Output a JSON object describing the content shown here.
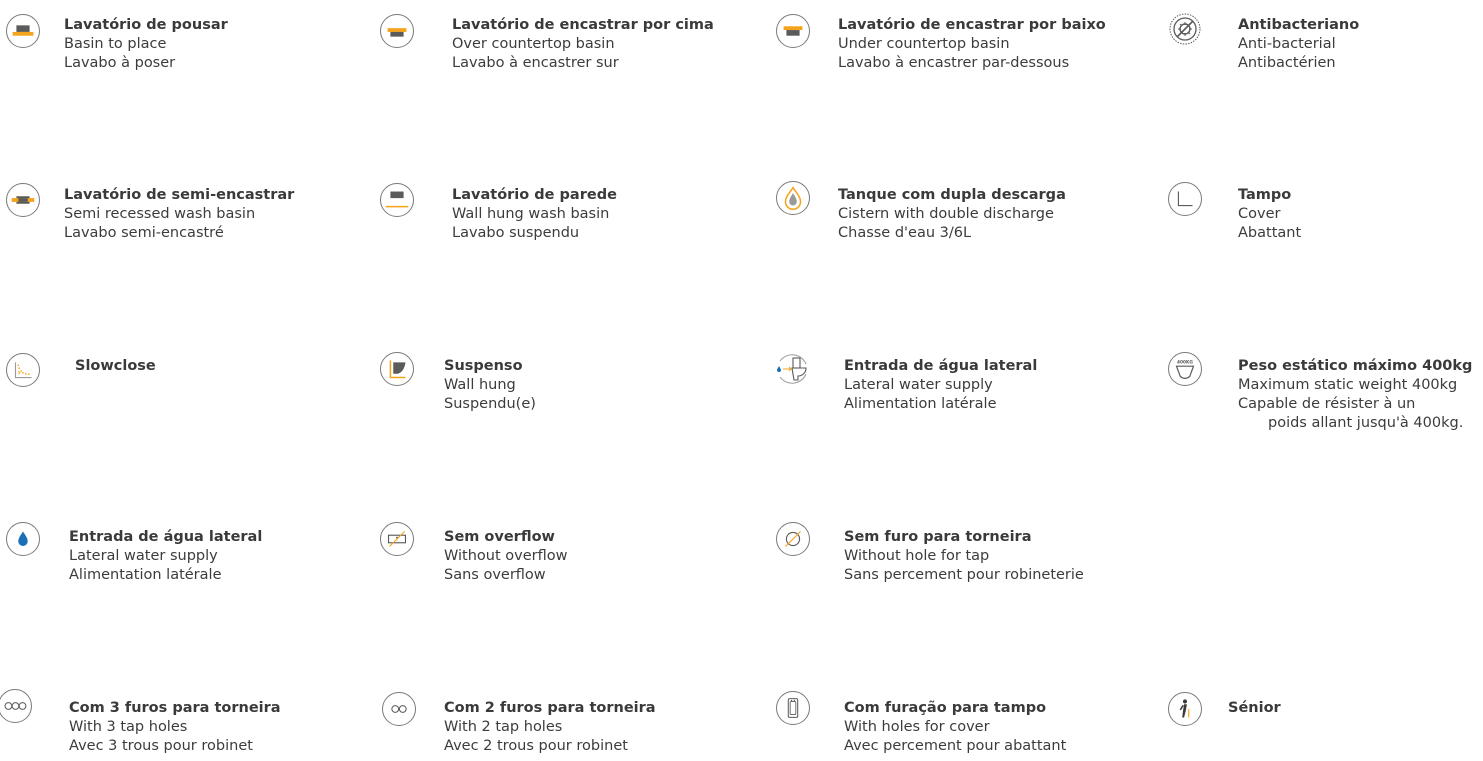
{
  "colors": {
    "accent": "#f4a31a",
    "dark": "#5b5b5b",
    "blue": "#1a6fb5",
    "ring": "#7a7a7a"
  },
  "items": [
    {
      "icon": "basin-to-place-icon",
      "title": "Lavatório de pousar",
      "en": "Basin to place",
      "fr": "Lavabo à poser"
    },
    {
      "icon": "over-countertop-basin-icon",
      "title": "Lavatório de encastrar por cima",
      "en": "Over countertop basin",
      "fr": "Lavabo à encastrer sur"
    },
    {
      "icon": "under-countertop-basin-icon",
      "title": "Lavatório de encastrar por baixo",
      "en": "Under countertop basin",
      "fr": "Lavabo à encastrer par-dessous"
    },
    {
      "icon": "antibacterial-icon",
      "title": "Antibacteriano",
      "en": "Anti-bacterial",
      "fr": "Antibactérien"
    },
    {
      "icon": "semi-recessed-basin-icon",
      "title": "Lavatório de semi-encastrar",
      "en": "Semi recessed wash basin",
      "fr": "Lavabo semi-encastré"
    },
    {
      "icon": "wall-hung-basin-icon",
      "title": "Lavatório de parede",
      "en": "Wall hung wash basin",
      "fr": "Lavabo suspendu"
    },
    {
      "icon": "double-discharge-drop-icon",
      "title": "Tanque com dupla descarga",
      "en": "Cistern with double discharge",
      "fr": "Chasse d'eau 3/6L"
    },
    {
      "icon": "cover-icon",
      "title": "Tampo",
      "en": "Cover",
      "fr": "Abattant"
    },
    {
      "icon": "slowclose-icon",
      "title": "Slowclose"
    },
    {
      "icon": "wall-hung-icon",
      "title": "Suspenso",
      "en": "Wall hung",
      "fr": "Suspendu(e)"
    },
    {
      "icon": "lateral-water-supply-toilet-icon",
      "title": "Entrada de água lateral",
      "en": "Lateral water supply",
      "fr": "Alimentation latérale"
    },
    {
      "icon": "static-weight-400kg-icon",
      "icon_label": "400KG",
      "title": "Peso estático máximo 400kg",
      "en": "Maximum static weight 400kg",
      "fr": "Capable de résister à un",
      "fr2": "poids allant jusqu'à 400kg."
    },
    {
      "icon": "water-drop-icon",
      "title": "Entrada de água lateral",
      "en": "Lateral water supply",
      "fr": "Alimentation latérale"
    },
    {
      "icon": "without-overflow-icon",
      "title": "Sem overflow",
      "en": "Without overflow",
      "fr": "Sans overflow"
    },
    {
      "icon": "no-tap-hole-icon",
      "title": "Sem furo para torneira",
      "en": "Without hole for tap",
      "fr": "Sans percement pour robineterie"
    },
    {
      "icon": "three-tap-holes-icon",
      "title": "Com 3 furos para torneira",
      "en": "With 3 tap holes",
      "fr": "Avec 3 trous pour robinet"
    },
    {
      "icon": "two-tap-holes-icon",
      "title": "Com 2 furos para torneira",
      "en": "With 2 tap holes",
      "fr": "Avec 2 trous pour robinet"
    },
    {
      "icon": "cover-holes-icon",
      "title": "Com furação para tampo",
      "en": "With holes for cover",
      "fr": "Avec percement pour abattant"
    },
    {
      "icon": "senior-icon",
      "title": "Sénior"
    }
  ]
}
